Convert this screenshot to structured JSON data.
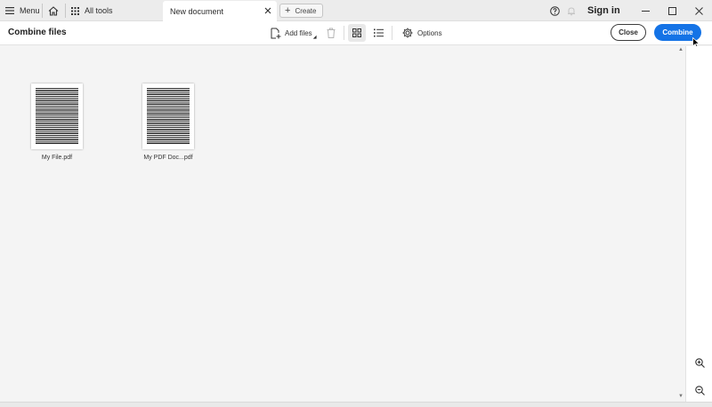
{
  "titlebar": {
    "menu_label": "Menu",
    "all_tools_label": "All tools",
    "tab_label": "New document",
    "create_label": "Create",
    "sign_in_label": "Sign in"
  },
  "toolbar": {
    "title": "Combine files",
    "add_files_label": "Add files",
    "options_label": "Options",
    "close_label": "Close",
    "combine_label": "Combine",
    "view_mode": "grid"
  },
  "files": [
    {
      "name": "My File.pdf"
    },
    {
      "name": "My PDF Doc...pdf"
    }
  ],
  "colors": {
    "accent": "#1473e6",
    "background": "#f4f4f4"
  },
  "icons": {
    "menu": "hamburger-icon",
    "home": "home-icon",
    "all_tools": "apps-grid-icon",
    "tab_close": "close-icon",
    "create": "plus-icon",
    "help": "help-icon",
    "notifications": "bell-icon",
    "add_files": "add-file-icon",
    "delete": "trash-icon",
    "grid_view": "grid-view-icon",
    "list_view": "list-view-icon",
    "options": "gear-icon",
    "zoom_in": "zoom-in-icon",
    "zoom_out": "zoom-out-icon"
  }
}
